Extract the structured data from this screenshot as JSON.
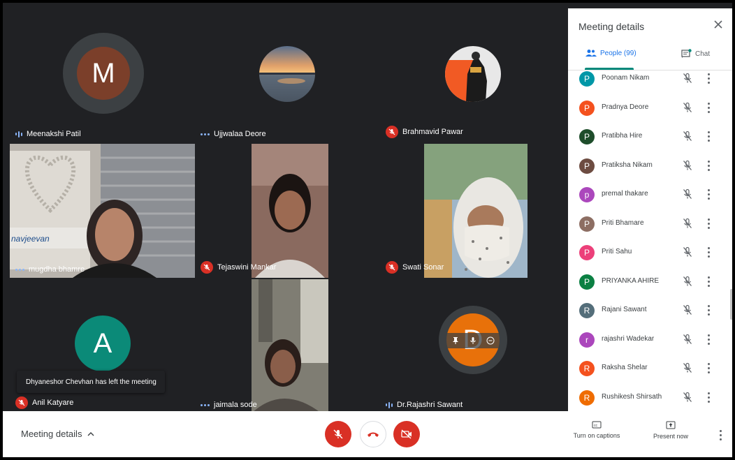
{
  "participants_tiles": [
    {
      "name": "Meenakshi Patil",
      "status": "speaking",
      "avatar_letter": "M",
      "avatar_color": "#7b3f2a"
    },
    {
      "name": "Ujjwalaa Deore",
      "status": "active"
    },
    {
      "name": "Brahmavid Pawar",
      "status": "muted"
    },
    {
      "name": "mugdha bhamre",
      "status": "active"
    },
    {
      "name": "Tejaswini Mankar",
      "status": "muted"
    },
    {
      "name": "Swati Sonar",
      "status": "muted"
    },
    {
      "name": "Anil Katyare",
      "status": "muted",
      "avatar_letter": "A",
      "avatar_color": "#0b8a78"
    },
    {
      "name": "jaimala sode",
      "status": "active"
    },
    {
      "name": "Dr.Rajashri Sawant",
      "status": "speaking",
      "avatar_letter": "D",
      "avatar_color": "#e8710a"
    }
  ],
  "toast": "Dhyaneshor Chevhan has left the meeting",
  "panel": {
    "title": "Meeting details",
    "tab_people": "People (99)",
    "tab_chat": "Chat",
    "people": [
      {
        "letter": "P",
        "name": "Poonam Nikam",
        "color": "#0097a7"
      },
      {
        "letter": "P",
        "name": "Pradnya Deore",
        "color": "#f4511e"
      },
      {
        "letter": "P",
        "name": "Pratibha Hire",
        "color": "#1e4d2b"
      },
      {
        "letter": "P",
        "name": "Pratiksha Nikam",
        "color": "#6d4c41"
      },
      {
        "letter": "p",
        "name": "premal thakare",
        "color": "#ab47bc"
      },
      {
        "letter": "P",
        "name": "Priti Bhamare",
        "color": "#8d6e63"
      },
      {
        "letter": "P",
        "name": "Priti Sahu",
        "color": "#ec407a"
      },
      {
        "letter": "P",
        "name": "PRIYANKA AHIRE",
        "color": "#0b8043"
      },
      {
        "letter": "R",
        "name": "Rajani Sawant",
        "color": "#546e7a"
      },
      {
        "letter": "r",
        "name": "rajashri Wadekar",
        "color": "#ab47bc"
      },
      {
        "letter": "R",
        "name": "Raksha Shelar",
        "color": "#f4511e"
      },
      {
        "letter": "R",
        "name": "Rushikesh Shirsath",
        "color": "#ef6c00"
      }
    ]
  },
  "bottom": {
    "meeting_details": "Meeting details",
    "captions": "Turn on captions",
    "present": "Present now"
  }
}
